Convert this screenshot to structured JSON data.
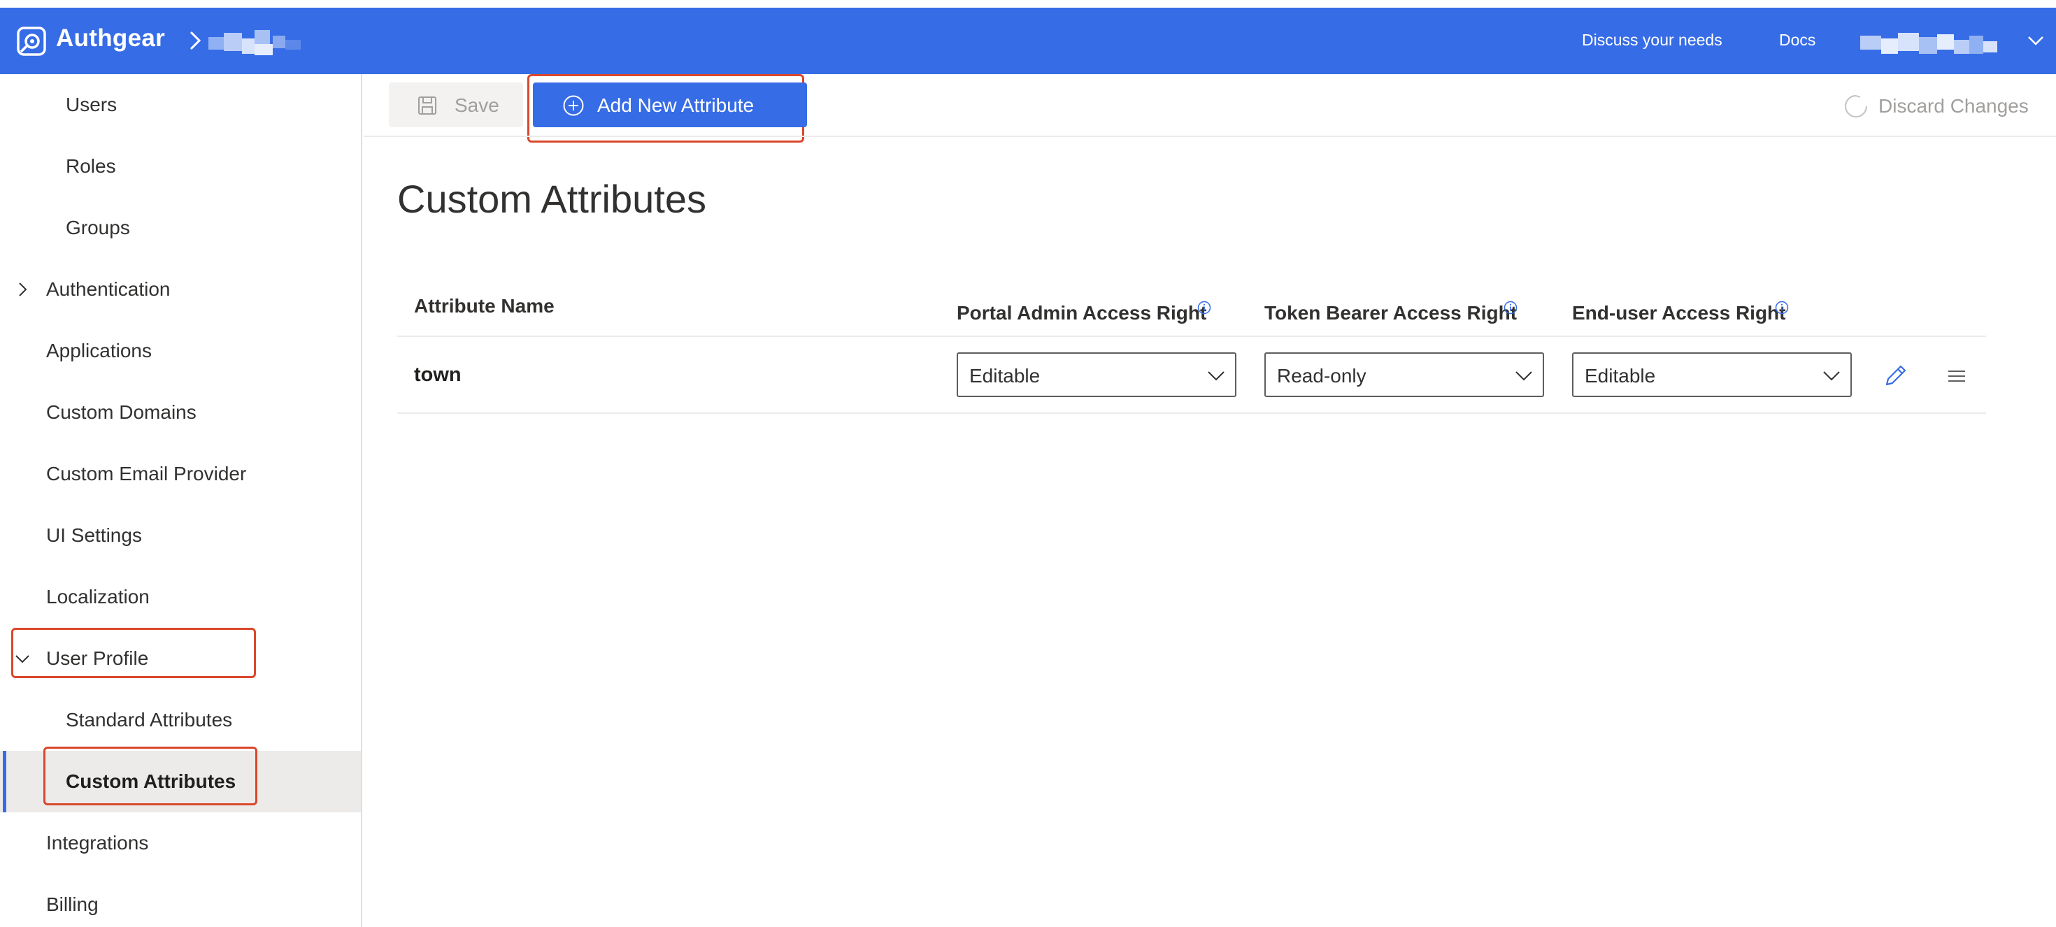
{
  "app": {
    "brand": "Authgear",
    "header_links": [
      "Discuss your needs",
      "Docs"
    ]
  },
  "sidebar": {
    "items": [
      {
        "label": "Users"
      },
      {
        "label": "Roles"
      },
      {
        "label": "Groups"
      },
      {
        "label": "Authentication",
        "expandable": true,
        "expanded": false
      },
      {
        "label": "Applications"
      },
      {
        "label": "Custom Domains"
      },
      {
        "label": "Custom Email Provider"
      },
      {
        "label": "UI Settings"
      },
      {
        "label": "Localization"
      },
      {
        "label": "User Profile",
        "expandable": true,
        "expanded": true
      },
      {
        "label": "Standard Attributes"
      },
      {
        "label": "Custom Attributes",
        "active": true
      },
      {
        "label": "Integrations"
      },
      {
        "label": "Billing"
      }
    ]
  },
  "toolbar": {
    "save_label": "Save",
    "add_label": "Add New Attribute",
    "discard_label": "Discard Changes"
  },
  "main": {
    "title": "Custom Attributes",
    "table": {
      "columns": [
        "Attribute Name",
        "Portal Admin Access Right",
        "Token Bearer Access Right",
        "End-user Access Right"
      ],
      "rows": [
        {
          "name": "town",
          "portal_admin": "Editable",
          "token_bearer": "Read-only",
          "end_user": "Editable"
        }
      ]
    }
  },
  "colors": {
    "accent": "#366ce6",
    "highlight": "#d9482b"
  }
}
